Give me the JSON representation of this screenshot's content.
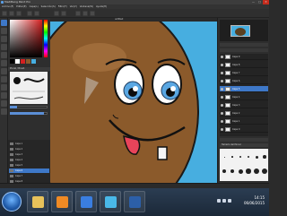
{
  "window": {
    "title": "MediBang Paint Pro",
    "controls": {
      "minimize": "—",
      "maximize": "□",
      "close": "✕"
    }
  },
  "menubar": [
    "Archivo(F)",
    "Editar(E)",
    "Capa(L)",
    "Selección(S)",
    "Filtro(T)",
    "Ver(V)",
    "Ventana(W)",
    "Ayuda(H)"
  ],
  "canvas": {
    "tab_label": "untitled"
  },
  "left_panel": {
    "brush_header": "Pincel / Brush",
    "layers": [
      {
        "name": "Capa 1"
      },
      {
        "name": "Capa 2"
      },
      {
        "name": "Capa 3"
      },
      {
        "name": "Capa 4"
      },
      {
        "name": "Capa 5"
      },
      {
        "name": "Capa 6",
        "selected": true
      },
      {
        "name": "Capa 7"
      },
      {
        "name": "Capa 8"
      }
    ],
    "sliders": [
      {
        "fill": 0.2
      },
      {
        "fill": 0.9
      }
    ]
  },
  "right_panel": {
    "navigator_header": "Navegador",
    "layers_header": "Capas",
    "layers": [
      {
        "name": "Capa 9"
      },
      {
        "name": "Capa 8"
      },
      {
        "name": "Capa 7"
      },
      {
        "name": "Capa 6"
      },
      {
        "name": "Capa 5",
        "selected": true
      },
      {
        "name": "Capa 4"
      },
      {
        "name": "Capa 3"
      },
      {
        "name": "Capa 2"
      },
      {
        "name": "Capa 1"
      },
      {
        "name": "Capa 0"
      }
    ],
    "brush_header": "Tamaño del Pincel"
  },
  "statusbar": {
    "text": ""
  },
  "taskbar": {
    "clock_time": "14:15",
    "clock_date": "06/06/2015"
  },
  "colors": {
    "sky": "#47aee0",
    "potato": "#8b5a2b",
    "accent": "#3e78c8"
  }
}
